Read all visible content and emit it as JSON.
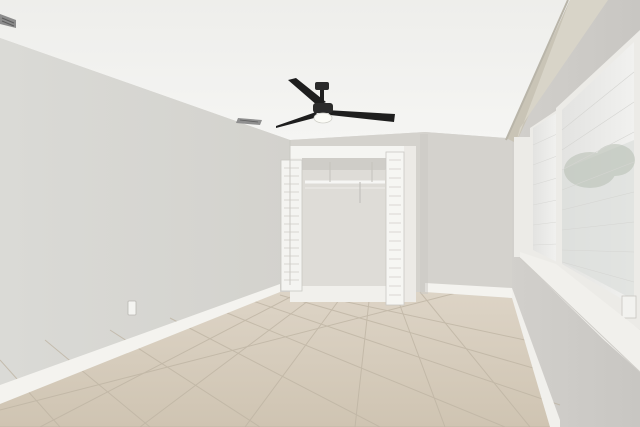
{
  "scene": {
    "description_tags": [
      "ceiling-fan",
      "closet",
      "bifold-doors",
      "windows",
      "tile-floor",
      "baseboards",
      "outlet",
      "air-vents"
    ]
  },
  "colors": {
    "ceiling": "#f2f2ef",
    "wall_left": "#d9d8d3",
    "wall_back": "#d3d1cc",
    "wall_right": "#cfcdca",
    "floor": "#d3c9b9",
    "baseboard": "#f4f3ef",
    "fan_blade": "#1e1e1e",
    "window_frame": "#ecebe7",
    "blind": "#e9e9e7"
  }
}
